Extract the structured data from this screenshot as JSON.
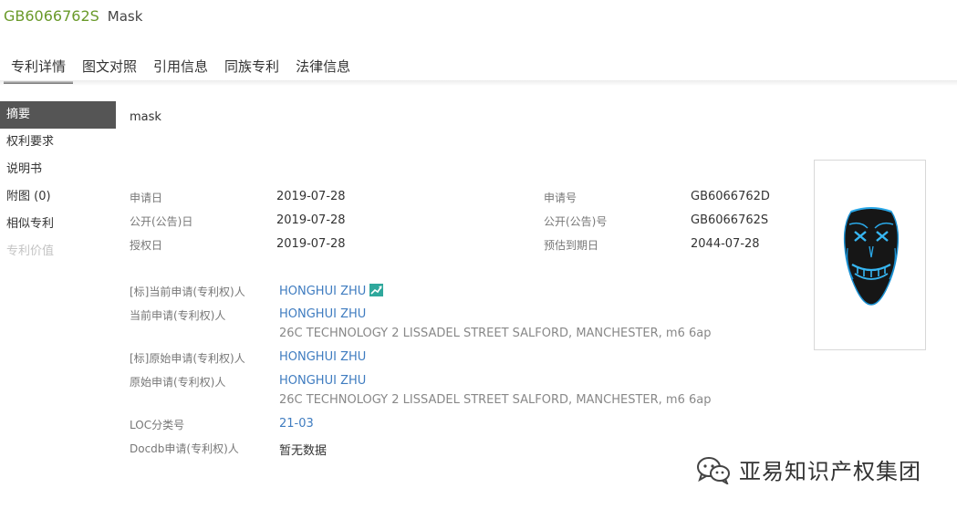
{
  "header": {
    "patent_number": "GB6066762S",
    "title": "Mask"
  },
  "tabs": [
    "专利详情",
    "图文对照",
    "引用信息",
    "同族专利",
    "法律信息"
  ],
  "sidebar": [
    {
      "label": "摘要",
      "active": true
    },
    {
      "label": "权利要求"
    },
    {
      "label": "说明书"
    },
    {
      "label": "附图 (0)"
    },
    {
      "label": "相似专利"
    },
    {
      "label": "专利价值",
      "disabled": true
    }
  ],
  "abstract": "mask",
  "fields": {
    "application_date": {
      "label": "申请日",
      "value": "2019-07-28"
    },
    "publication_date": {
      "label": "公开(公告)日",
      "value": "2019-07-28"
    },
    "grant_date": {
      "label": "授权日",
      "value": "2019-07-28"
    },
    "application_number": {
      "label": "申请号",
      "value": "GB6066762D"
    },
    "publication_number": {
      "label": "公开(公告)号",
      "value": "GB6066762S"
    },
    "expiry_date": {
      "label": "预估到期日",
      "value": "2044-07-28"
    }
  },
  "parties": {
    "std_current_applicant": {
      "label": "[标]当前申请(专利权)人",
      "value": "HONGHUI ZHU"
    },
    "current_applicant": {
      "label": "当前申请(专利权)人",
      "value": "HONGHUI ZHU",
      "address": "26C TECHNOLOGY 2 LISSADEL STREET SALFORD, MANCHESTER, m6 6ap"
    },
    "std_original_applicant": {
      "label": "[标]原始申请(专利权)人",
      "value": "HONGHUI ZHU"
    },
    "original_applicant": {
      "label": "原始申请(专利权)人",
      "value": "HONGHUI ZHU",
      "address": "26C TECHNOLOGY 2 LISSADEL STREET SALFORD, MANCHESTER, m6 6ap"
    },
    "loc_class": {
      "label": "LOC分类号",
      "value": "21-03"
    },
    "docdb_applicant": {
      "label": "Docdb申请(专利权)人",
      "value": "暂无数据"
    }
  },
  "watermark": {
    "text": "亚易知识产权集团",
    "icon": "wechat-icon"
  },
  "colors": {
    "patent_number": "#6a9a2a",
    "link": "#3f7cc0",
    "active_nav": "#555555",
    "badge": "#2fa89c"
  }
}
